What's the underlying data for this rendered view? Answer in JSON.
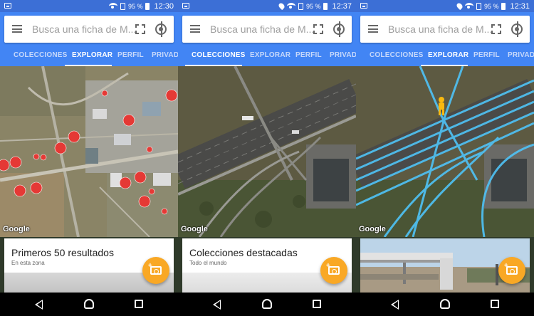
{
  "colors": {
    "status_bar": "#3c6fd6",
    "app_bar": "#4285f4",
    "fab": "#f9a825",
    "result_dot": "#e53935",
    "street_view_line": "#4fc3f7",
    "pegman": "#f9b90f"
  },
  "screens": [
    {
      "status": {
        "battery": "95 %",
        "time": "12:30"
      },
      "search": {
        "placeholder": "Busca una ficha de M..."
      },
      "tabs": [
        "COLECCIONES",
        "EXPLORAR",
        "PERFIL",
        "PRIVADA"
      ],
      "active_tab": "EXPLORAR",
      "map_logo": "Google",
      "card": {
        "title": "Primeros 50 resultados",
        "subtitle": "En esta zona"
      },
      "fab_icon": "add-photo-icon"
    },
    {
      "status": {
        "battery": "95 %",
        "time": "12:37"
      },
      "search": {
        "placeholder": "Busca una ficha de M..."
      },
      "tabs": [
        "COLECCIONES",
        "EXPLORAR",
        "PERFIL",
        "PRIVADA"
      ],
      "active_tab": "COLECCIONES",
      "map_logo": "Google",
      "card": {
        "title": "Colecciones destacadas",
        "subtitle": "Todo el mundo"
      },
      "fab_icon": "add-photo-icon"
    },
    {
      "status": {
        "battery": "95 %",
        "time": "12:31"
      },
      "search": {
        "placeholder": "Busca una ficha de M..."
      },
      "tabs": [
        "COLECCIONES",
        "EXPLORAR",
        "PERFIL",
        "PRIVADA"
      ],
      "active_tab": "EXPLORAR",
      "map_logo": "Google",
      "card": {
        "title": "",
        "subtitle": ""
      },
      "fab_icon": "add-photo-icon"
    }
  ]
}
